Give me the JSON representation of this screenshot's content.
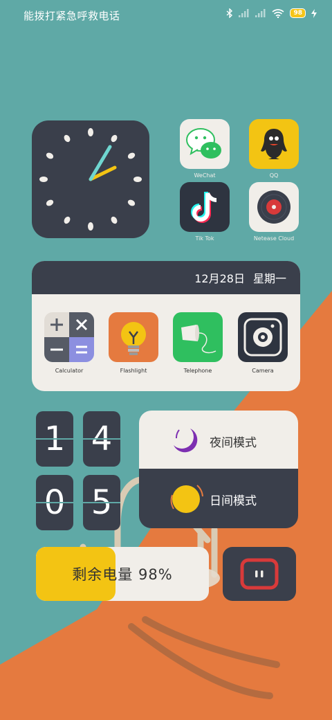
{
  "status_bar": {
    "carrier_text": "能拨打紧急呼救电话",
    "battery_percent_label": "98",
    "icons": [
      "bluetooth-icon",
      "signal-icon",
      "signal-icon",
      "wifi-icon",
      "battery-icon",
      "charging-icon"
    ]
  },
  "clock_widget": {
    "hour": 2,
    "minute": 5
  },
  "apps": [
    {
      "label": "WeChat",
      "icon": "wechat-icon"
    },
    {
      "label": "QQ",
      "icon": "qq-icon"
    },
    {
      "label": "Tik Tok",
      "icon": "tiktok-icon"
    },
    {
      "label": "Netease Cloud",
      "icon": "netease-cloud-icon"
    }
  ],
  "dock": {
    "date": "12月28日",
    "weekday": "星期一",
    "apps": [
      {
        "label": "Calculator",
        "icon": "calculator-icon"
      },
      {
        "label": "Flashlight",
        "icon": "flashlight-icon"
      },
      {
        "label": "Telephone",
        "icon": "telephone-icon"
      },
      {
        "label": "Camera",
        "icon": "camera-icon"
      }
    ]
  },
  "flip_clock": {
    "digits": [
      "1",
      "4",
      "0",
      "5"
    ]
  },
  "mode_switch": {
    "night_label": "夜间模式",
    "day_label": "日间模式"
  },
  "battery": {
    "text": "剩余电量 98%",
    "level": 0.46
  },
  "colors": {
    "teal": "#5fa9a6",
    "orange": "#e57a3f",
    "dark": "#3a3f4b",
    "cream": "#f1eee9",
    "yellow": "#f3c413"
  }
}
